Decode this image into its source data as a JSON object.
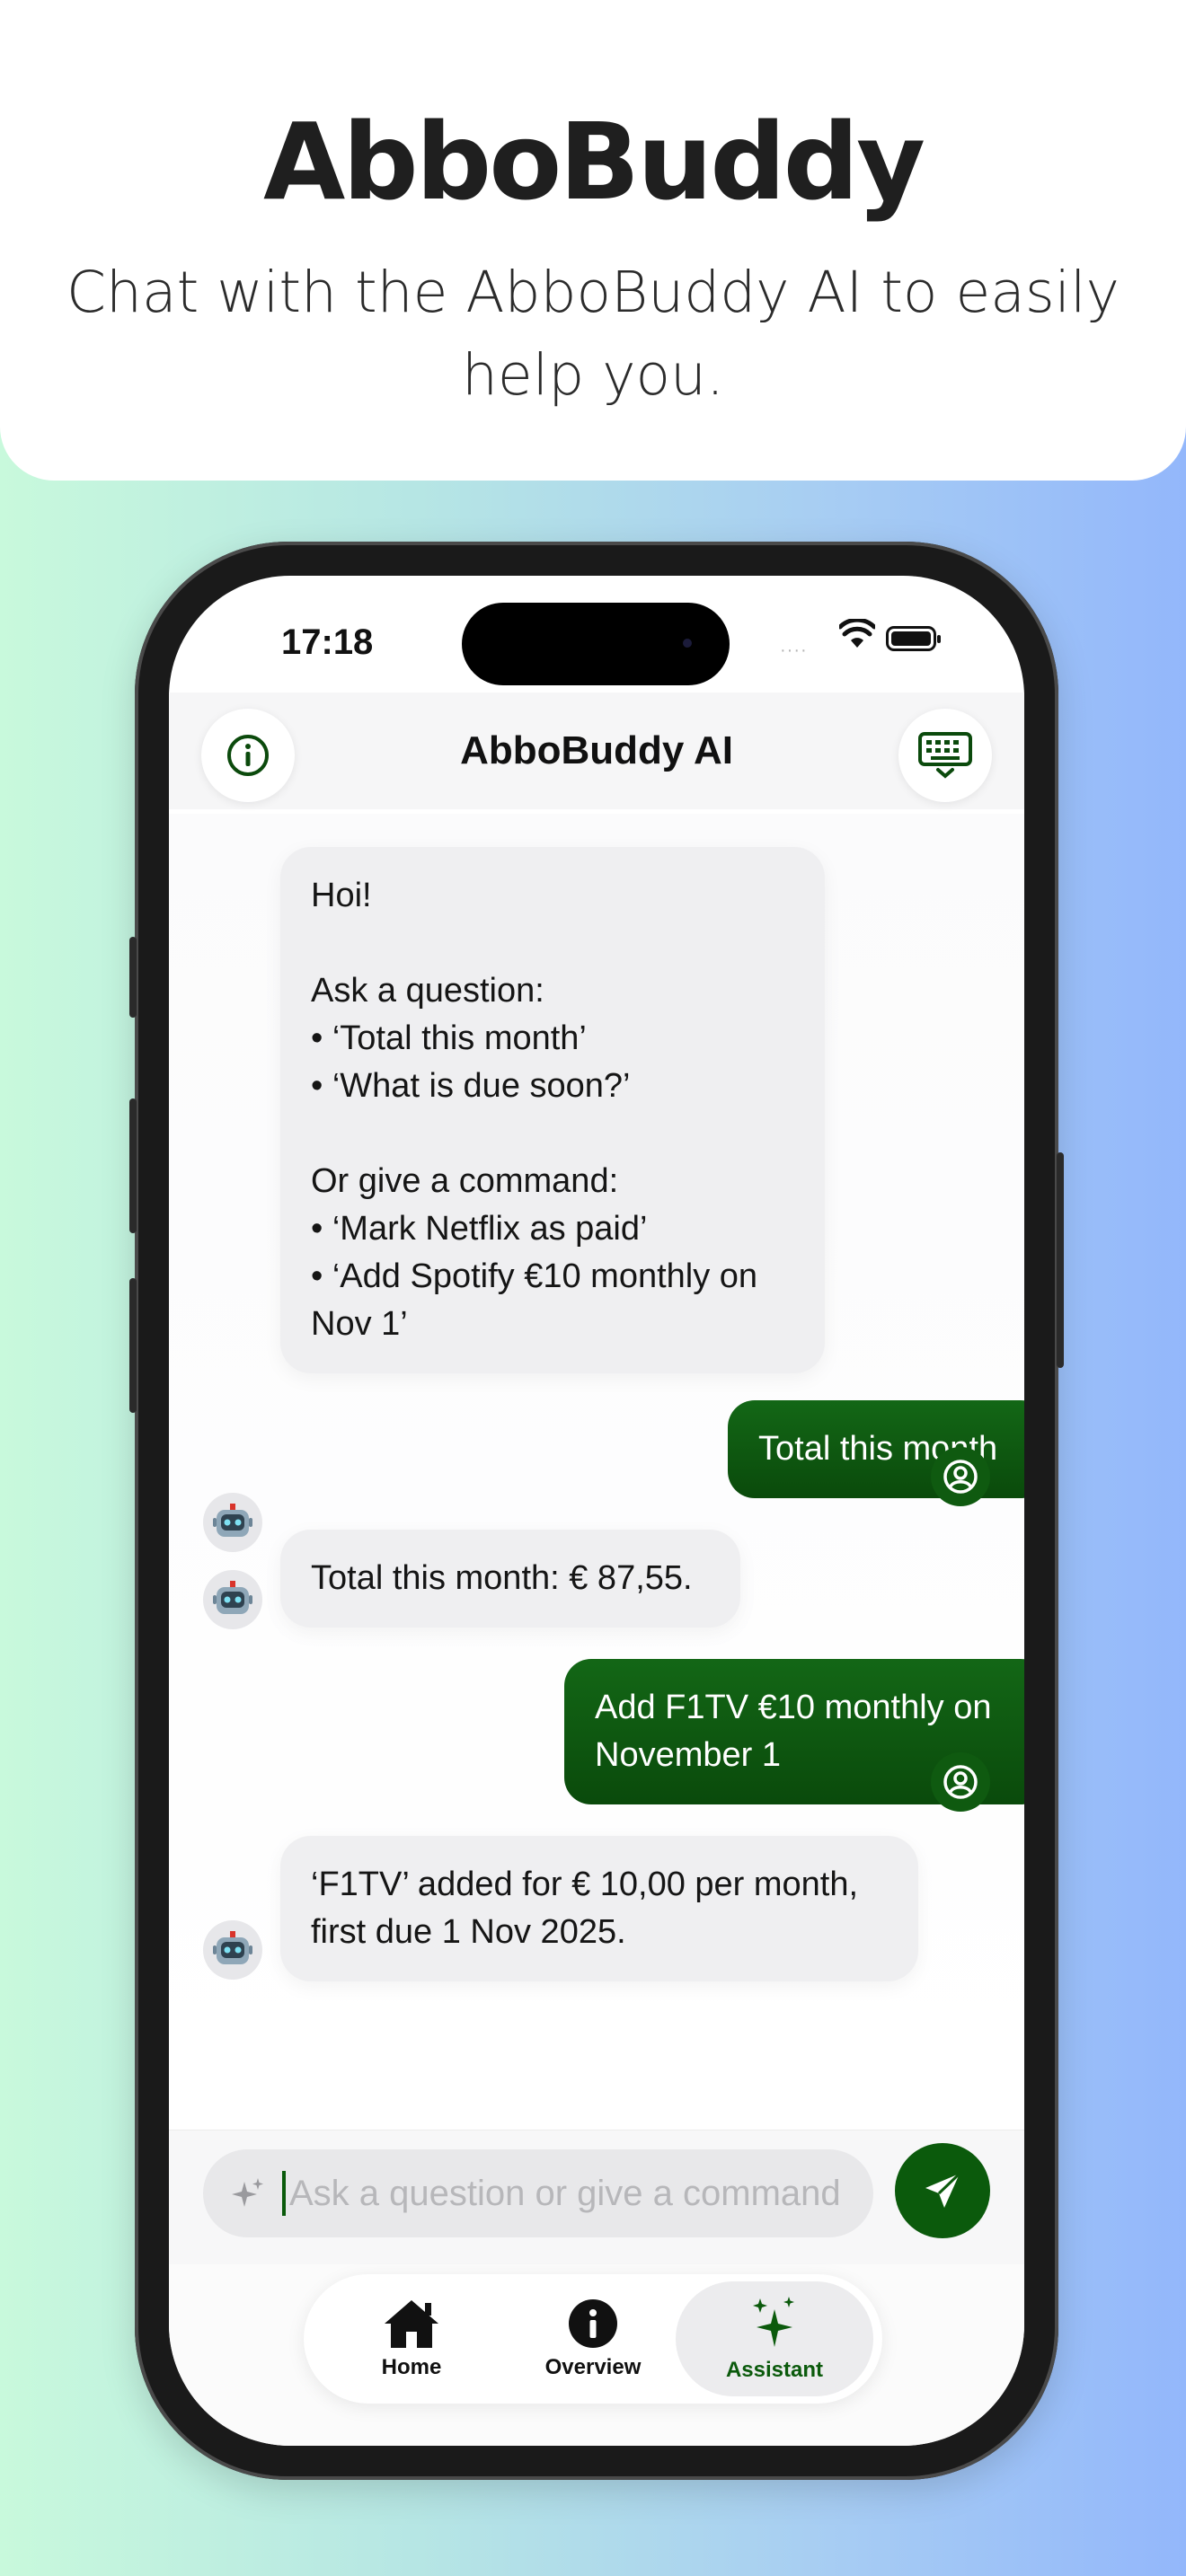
{
  "promo": {
    "title": "AbboBuddy",
    "subtitle": "Chat with the AbboBuddy AI to easily help you."
  },
  "status_bar": {
    "time": "17:18",
    "signal": "····"
  },
  "header": {
    "title": "AbboBuddy AI",
    "left_icon": "info-icon",
    "right_icon": "keyboard-dismiss-icon"
  },
  "messages": [
    {
      "role": "assistant",
      "lines": [
        "Hoi!",
        "",
        "Ask a question:",
        "• ‘Total this month’",
        "• ‘What is due soon?’",
        "",
        "Or give a command:",
        "• ‘Mark Netflix as paid’",
        "• ‘Add Spotify €10 monthly on",
        "Nov 1’"
      ]
    },
    {
      "role": "user",
      "lines": [
        "Total this month"
      ]
    },
    {
      "role": "assistant",
      "lines": [
        "Total this month: € 87,55."
      ]
    },
    {
      "role": "user",
      "lines": [
        "Add F1TV €10 monthly on",
        "November 1"
      ]
    },
    {
      "role": "assistant",
      "lines": [
        "‘F1TV’ added for € 10,00 per month,",
        "first due 1 Nov 2025."
      ]
    }
  ],
  "composer": {
    "placeholder": "Ask a question or give a command",
    "value": "",
    "send_icon": "send-icon"
  },
  "tabs": [
    {
      "label": "Home",
      "icon": "house-icon",
      "active": false
    },
    {
      "label": "Overview",
      "icon": "info-circle-icon",
      "active": false
    },
    {
      "label": "Assistant",
      "icon": "sparkles-icon",
      "active": true
    }
  ],
  "colors": {
    "accent": "#0b5a0c",
    "bot_bubble": "#efeff1",
    "user_bubble": "#0f5f11"
  }
}
